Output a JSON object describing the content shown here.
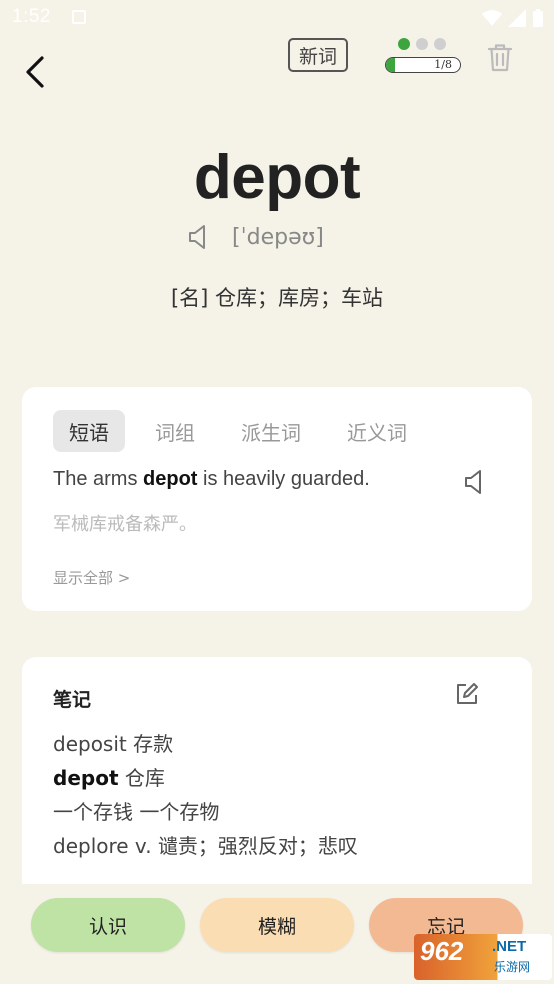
{
  "status": {
    "time": "1:52"
  },
  "header": {
    "new_badge": "新词",
    "progress_text": "1/8",
    "progress_fraction": 0.125,
    "dots_active": 1,
    "dots_total": 3
  },
  "word": {
    "text": "depot",
    "phonetic": "[ˈdepəʊ]",
    "definition": "[名] 仓库；库房；车站"
  },
  "tabs": [
    {
      "label": "短语",
      "active": true
    },
    {
      "label": "词组",
      "active": false
    },
    {
      "label": "派生词",
      "active": false
    },
    {
      "label": "近义词",
      "active": false
    }
  ],
  "example": {
    "before": "The arms ",
    "bold": "depot",
    "after": " is heavily guarded.",
    "translation": "军械库戒备森严。",
    "show_all": "显示全部 >"
  },
  "notes": {
    "title": "笔记",
    "lines": [
      {
        "bold": "",
        "text": "deposit 存款"
      },
      {
        "bold": "depot",
        "text": " 仓库"
      },
      {
        "bold": "",
        "text": "一个存钱 一个存物"
      },
      {
        "bold": "",
        "text": "deplore v. 谴责；强烈反对；悲叹"
      }
    ]
  },
  "buttons": {
    "know": "认识",
    "vague": "模糊",
    "forget": "忘记"
  },
  "watermark": {
    "logo": "962",
    "text": ".NET",
    "sub": "乐游网"
  },
  "colors": {
    "background": "#f5f2e8",
    "accent_green": "#3da53d",
    "know_btn": "#bfe3a4",
    "vague_btn": "#fbddb4",
    "forget_btn": "#f3b993"
  }
}
